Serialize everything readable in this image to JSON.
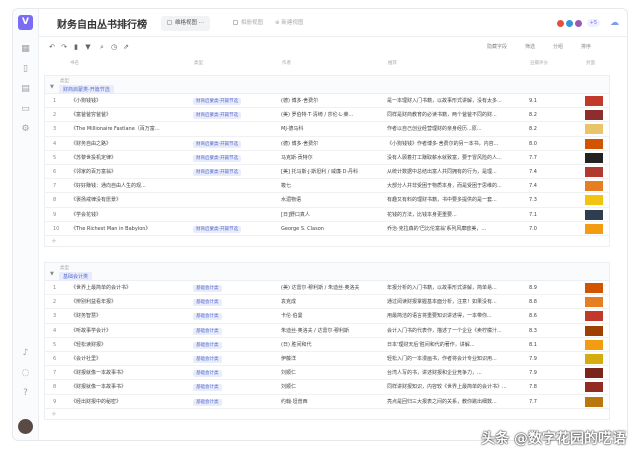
{
  "header": {
    "title": "财务自由丛书排行榜",
    "tabs": [
      {
        "label": "维格视图",
        "active": true
      },
      {
        "label": "相册视图",
        "active": false
      },
      {
        "label": "新建视图",
        "active": false
      }
    ]
  },
  "columns": [
    "书名",
    "类型",
    "作者",
    "推荐",
    "豆瓣评分",
    "封面"
  ],
  "groups": [
    {
      "group_label": "类型",
      "group_tag": "财商启蒙类-开篇节选",
      "rows": [
        {
          "num": "1",
          "name": "《小狗钱钱》",
          "cat": "财商启蒙类-开篇节选",
          "author": "(德) 博多·舍费尔",
          "summary": "是一本理财入门书籍，以故事形式讲解，没有太多...",
          "score": "9.1",
          "cover": "#c0392b"
        },
        {
          "num": "2",
          "name": "《富爸爸穷爸爸》",
          "cat": "财商启蒙类-开篇节选",
          "author": "(美) 罗伯特·T·清崎 / 莎伦·L·莱...",
          "summary": "同样是财商教育的必读书籍，两个爸爸不同的财...",
          "score": "8.2",
          "cover": "#8e2d2d"
        },
        {
          "num": "3",
          "name": "《The Millionaire Fastlane（百万富...",
          "cat": "",
          "author": "MJ·德马科",
          "summary": "作者以自己创业经营理财的亲身经历...原...",
          "score": "8.2",
          "cover": "#e9c46a"
        },
        {
          "num": "4",
          "name": "《财务自由之路》",
          "cat": "财商启蒙类-开篇节选",
          "author": "(德) 博多·舍费尔",
          "summary": "《小狗钱钱》作者博多·舍费尔的另一本书，内容...",
          "score": "8.0",
          "cover": "#d35400"
        },
        {
          "num": "5",
          "name": "《苏黎世投机定律》",
          "cat": "财商启蒙类-开篇节选",
          "author": "马克斯·贡特尔",
          "summary": "没有人顾着打工赚取薪水就致富，要于冒风险的人...",
          "score": "7.7",
          "cover": "#222222"
        },
        {
          "num": "6",
          "name": "《邻家的百万富翁》",
          "cat": "财商启蒙类-开篇节选",
          "author": "[美] 托马斯·J·斯坦利 / 威廉·D·丹科",
          "summary": "从统计数据中总结出富人共同拥有的行为，是理...",
          "score": "7.4",
          "cover": "#b03a2e"
        },
        {
          "num": "7",
          "name": "《好好赚钱：通向自由人生的观...",
          "cat": "",
          "author": "筱七",
          "summary": "大部分人并非受困于物质本身，而是受困于思维的...",
          "score": "7.4",
          "cover": "#e67e22"
        },
        {
          "num": "8",
          "name": "《褒扬戒律没有愿景》",
          "cat": "",
          "author": "水湄物语",
          "summary": "有趣又有料的理财书籍，书中要多提供的是一套...",
          "score": "7.3",
          "cover": "#f1c40f"
        },
        {
          "num": "9",
          "name": "《学会花钱》",
          "cat": "",
          "author": "[日]野口真人",
          "summary": "花钱的方法，比钱本身更重要...",
          "score": "7.1",
          "cover": "#2c3e50"
        },
        {
          "num": "10",
          "name": "《The Richest Man in Babylon》",
          "cat": "财商启蒙类-开篇节选",
          "author": "George S. Clason",
          "summary": "乔治·克拉森的'巴比伦富翁'系列风靡欧美，...",
          "score": "7.0",
          "cover": "#f39c12"
        }
      ]
    },
    {
      "group_label": "类型",
      "group_tag": "基础会计类",
      "rows": [
        {
          "num": "1",
          "name": "《世界上最简单的会计书》",
          "cat": "基础会计类",
          "author": "(美) 达雷尔·穆利斯 / 朱迪丝·奥洛夫",
          "summary": "年报分析的入门书籍，以故事形式讲解，简单易...",
          "score": "8.9",
          "cover": "#d35400"
        },
        {
          "num": "2",
          "name": "《辨别利益看年报》",
          "cat": "基础会计类",
          "author": "袁克成",
          "summary": "通过阅读财报掌握基本面分析，注意！如果没有...",
          "score": "8.8",
          "cover": "#e67e22"
        },
        {
          "num": "3",
          "name": "《财务智慧》",
          "cat": "基础会计类",
          "author": "卡伦·伯曼",
          "summary": "用最简洁的语言将重要知识讲述得，一本带你...",
          "score": "8.6",
          "cover": "#c0392b"
        },
        {
          "num": "4",
          "name": "《听故事学会计》",
          "cat": "基础会计类",
          "author": "朱迪丝·奥洛夫 / 达雷尔·穆利斯",
          "summary": "会计入门书的代表作，描述了一个企业《卖柠檬汁...",
          "score": "8.3",
          "cover": "#a04000"
        },
        {
          "num": "5",
          "name": "《轻松读财报》",
          "cat": "基础会计类",
          "author": "(日) 胜间和代",
          "summary": "日本'理财天后'胜间和代的著作，讲解...",
          "score": "8.1",
          "cover": "#f39c12"
        },
        {
          "num": "6",
          "name": "《会计社里》",
          "cat": "基础会计类",
          "author": "伊藤洋",
          "summary": "轻松入门的一本漫画书，作者将会计专业知识用...",
          "score": "7.9",
          "cover": "#d4ac0d"
        },
        {
          "num": "7",
          "name": "《财报就像一本故事书》",
          "cat": "基础会计类",
          "author": "刘顺仁",
          "summary": "台湾人写的书，讲述财报和企业竞争力，...",
          "score": "7.9",
          "cover": "#7b241c"
        },
        {
          "num": "8",
          "name": "《财报就像一本故事书》",
          "cat": "基础会计类",
          "author": "刘顺仁",
          "summary": "同样讲财报知识，内容较《世界上最简单的会计书》...",
          "score": "7.8",
          "cover": "#922b21"
        },
        {
          "num": "9",
          "name": "《经出财报中的秘密》",
          "cat": "基础会计类",
          "author": "约翰·坦普西",
          "summary": "亮点是回归三大报表之间的关系，教你跳出细数...",
          "score": "7.7",
          "cover": "#b9770e"
        }
      ]
    }
  ],
  "toolbar": {
    "filter_label": "筛选",
    "group_label": "分组",
    "sort_label": "排序",
    "hidden_fields_label": "隐藏字段"
  },
  "watermark": "头条 @数字花园的呓语"
}
